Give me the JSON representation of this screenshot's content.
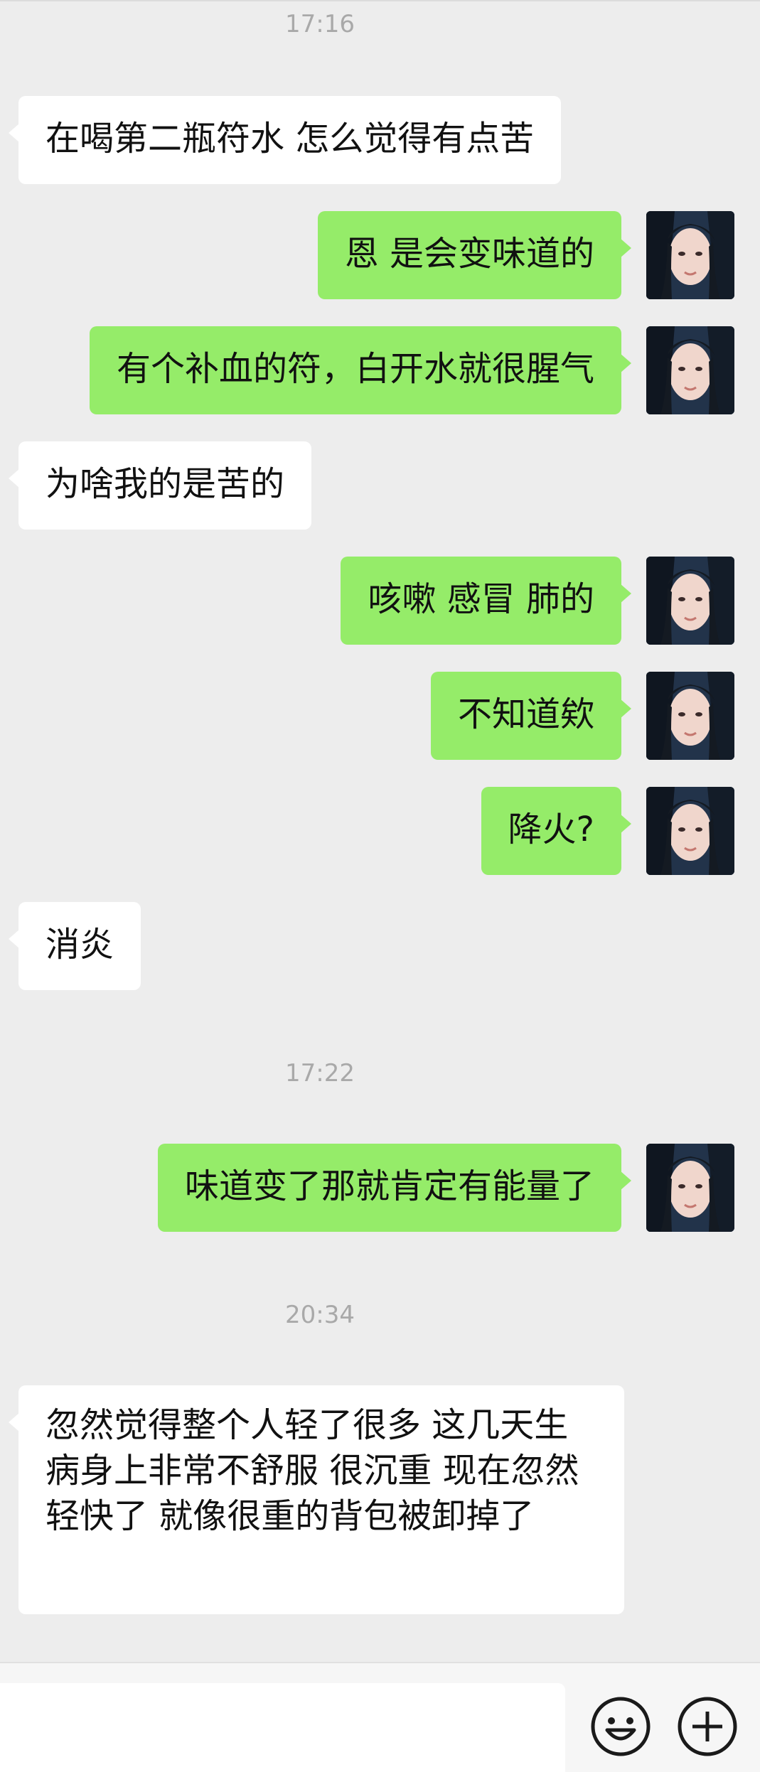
{
  "timestamps": [
    "17:16",
    "17:22",
    "20:34"
  ],
  "messages": [
    {
      "side": "left",
      "text": "在喝第二瓶符水 怎么觉得有点苦"
    },
    {
      "side": "right",
      "text": "恩 是会变味道的"
    },
    {
      "side": "right",
      "text": "有个补血的符，白开水就很腥气"
    },
    {
      "side": "left",
      "text": "为啥我的是苦的"
    },
    {
      "side": "right",
      "text": "咳嗽 感冒 肺的"
    },
    {
      "side": "right",
      "text": "不知道欸"
    },
    {
      "side": "right",
      "text": "降火?"
    },
    {
      "side": "left",
      "text": "消炎"
    },
    {
      "side": "right",
      "text": "味道变了那就肯定有能量了"
    },
    {
      "side": "left",
      "text": "忽然觉得整个人轻了很多 这几天生病身上非常不舒服 很沉重 现在忽然轻快了 就像很重的背包被卸掉了"
    }
  ],
  "input": {
    "placeholder": ""
  },
  "icons": {
    "emoji": "emoji-icon",
    "plus": "plus-icon"
  },
  "colors": {
    "background": "#ededed",
    "sent_bubble": "#95ec69",
    "received_bubble": "#ffffff"
  }
}
